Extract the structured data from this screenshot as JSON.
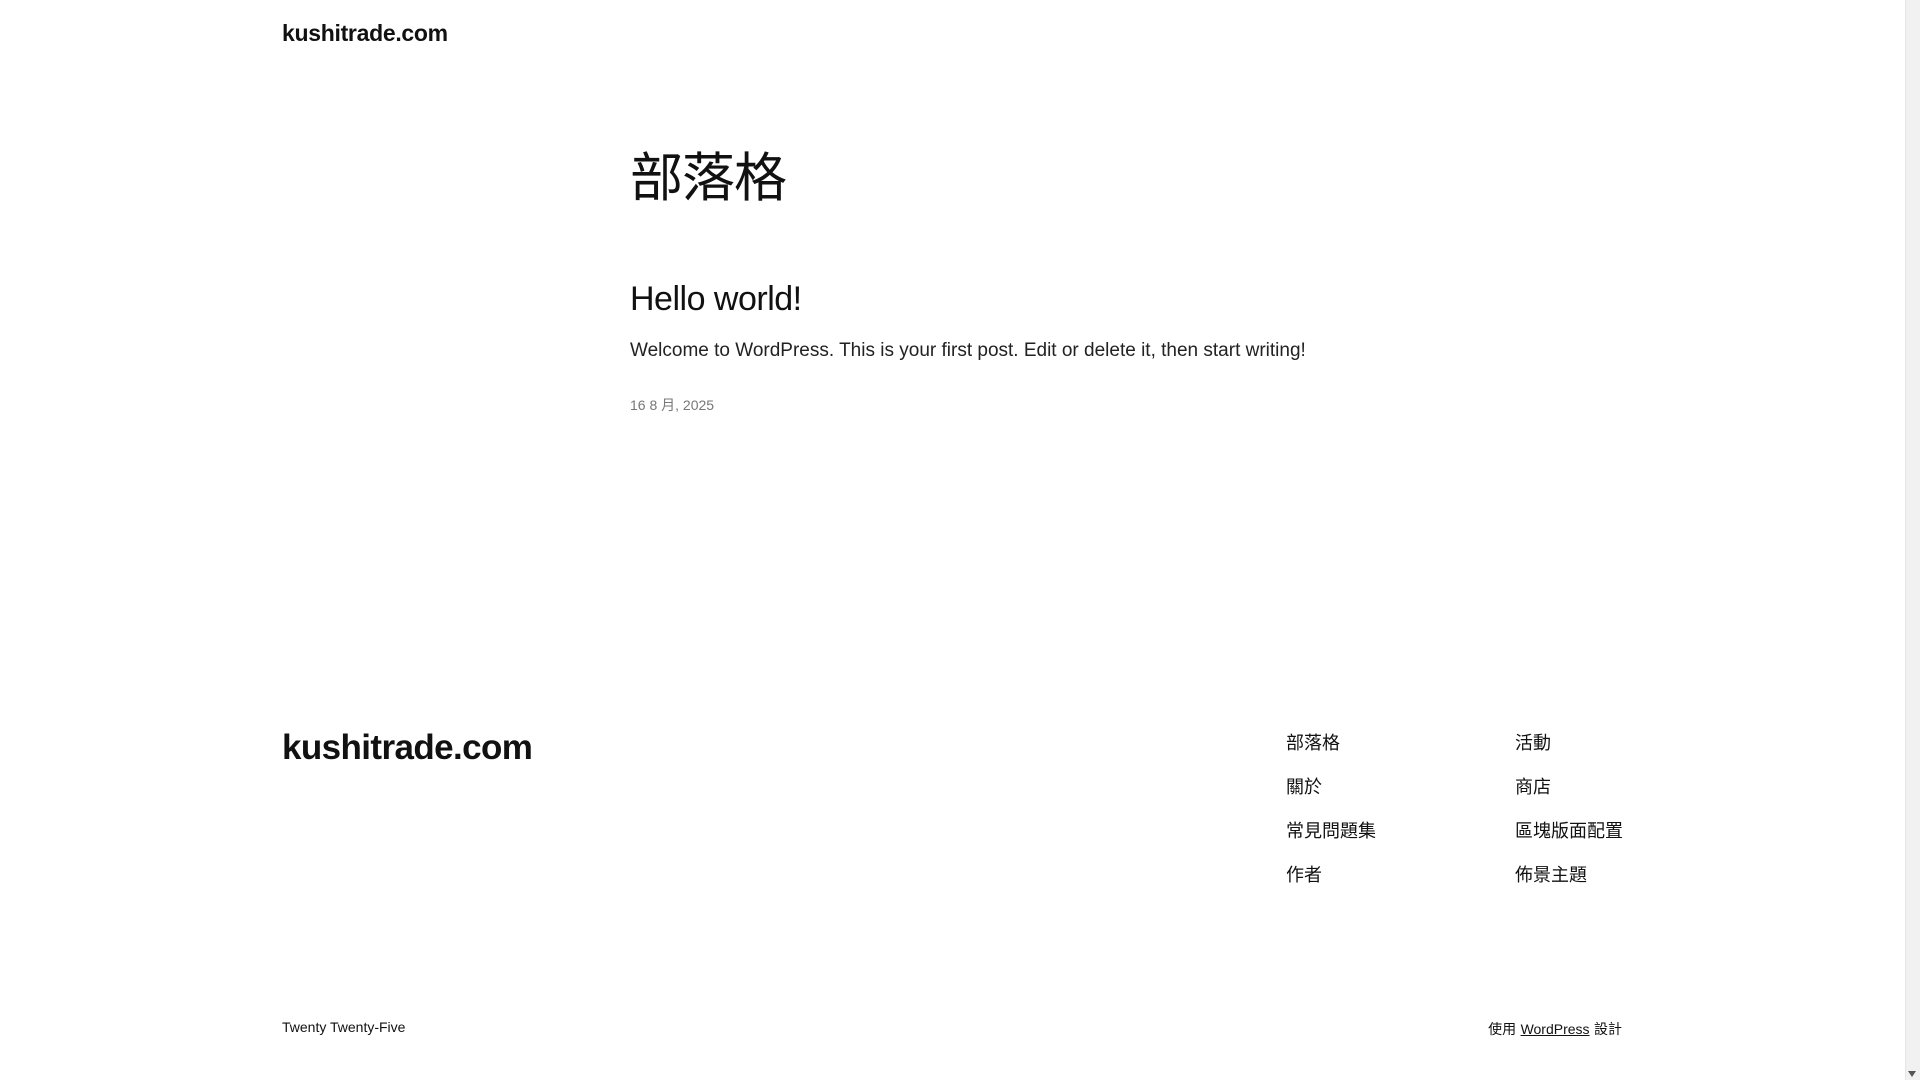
{
  "header": {
    "site_title": "kushitrade.com"
  },
  "page": {
    "heading": "部落格"
  },
  "post": {
    "title": "Hello world!",
    "excerpt": "Welcome to WordPress. This is your first post. Edit or delete it, then start writing!",
    "date": "16 8 月, 2025"
  },
  "footer": {
    "site_title": "kushitrade.com",
    "nav_col1": [
      "部落格",
      "關於",
      "常見問題集",
      "作者"
    ],
    "nav_col2": [
      "活動",
      "商店",
      "區塊版面配置",
      "佈景主題"
    ],
    "theme_credit": "Twenty Twenty-Five",
    "powered_prefix": "使用",
    "powered_link": "WordPress",
    "powered_suffix": "設計"
  },
  "scrollbar": {
    "arrow_icon": "chevron-down-icon"
  }
}
